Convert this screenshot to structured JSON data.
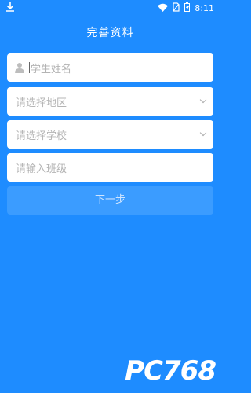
{
  "status_bar": {
    "time": "8:11",
    "icons": [
      "download-icon",
      "wifi-icon",
      "no-sim-icon",
      "battery-icon"
    ]
  },
  "header": {
    "title": "完善资料"
  },
  "form": {
    "name": {
      "placeholder": "学生姓名"
    },
    "region": {
      "placeholder": "请选择地区"
    },
    "school": {
      "placeholder": "请选择学校"
    },
    "class": {
      "placeholder": "请输入班级"
    }
  },
  "actions": {
    "next_label": "下一步"
  },
  "watermark": {
    "text": "PC768"
  },
  "colors": {
    "background": "#1e8cff",
    "button": "#3b9cff",
    "placeholder": "#b4b4b4"
  }
}
